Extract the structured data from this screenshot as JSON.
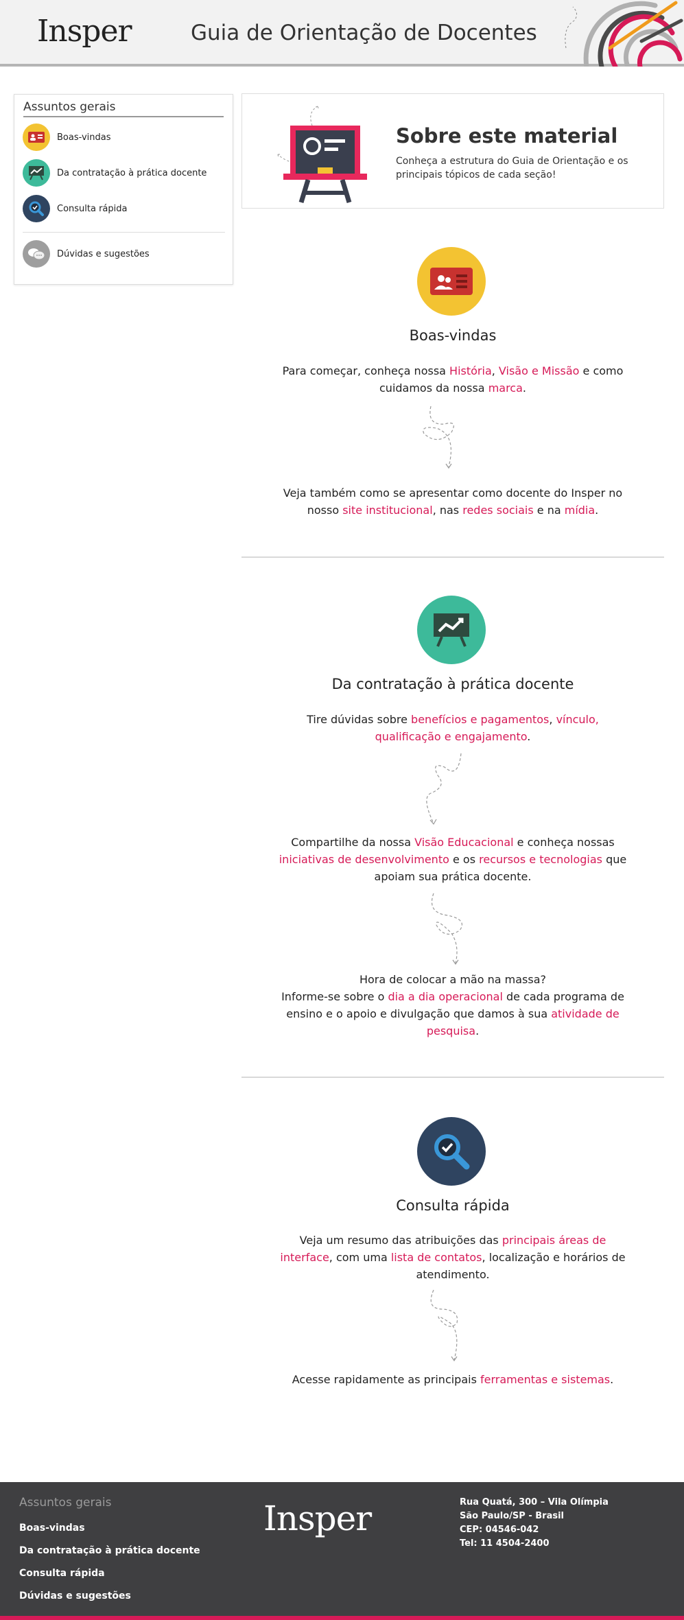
{
  "header": {
    "logo": "Insper",
    "title": "Guia de Orientação de Docentes"
  },
  "sidebar": {
    "title": "Assuntos gerais",
    "items": [
      {
        "label": "Boas-vindas",
        "color": "#f3c332"
      },
      {
        "label": "Da contratação à prática docente",
        "color": "#3dba9a"
      },
      {
        "label": "Consulta rápida",
        "color": "#2f4460"
      },
      {
        "label": "Dúvidas e sugestões",
        "color": "#9e9e9e"
      }
    ]
  },
  "sobre": {
    "title": "Sobre este material",
    "desc": "Conheça a estrutura do Guia de Orientação e os principais tópicos de cada seção!"
  },
  "s1": {
    "title": "Boas-vindas",
    "p1": {
      "a": "Para começar, conheça nossa ",
      "l1": "História",
      "b": ", ",
      "l2": "Visão e Missão",
      "c": " e como cuidamos da nossa ",
      "l3": "marca",
      "d": "."
    },
    "p2": {
      "a": "Veja também como se apresentar como docente do Insper no nosso ",
      "l1": "site institucional",
      "b": ", nas ",
      "l2": "redes sociais",
      "c": " e na ",
      "l3": "mídia",
      "d": "."
    }
  },
  "s2": {
    "title": "Da contratação à prática docente",
    "p1": {
      "a": "Tire dúvidas sobre ",
      "l1": "benefícios e pagamentos",
      "b": ", ",
      "l2": "vínculo,",
      "c": " ",
      "l3": "qualificação e engajamento",
      "d": "."
    },
    "p2": {
      "a": "Compartilhe da nossa ",
      "l1": "Visão Educacional",
      "b": " e conheça nossas ",
      "l2": "iniciativas de desenvolvimento",
      "c": " e os ",
      "l3": "recursos e tecnologias",
      "d": " que apoiam sua prática docente."
    },
    "p3": {
      "line1": "Hora de colocar a mão na massa?",
      "a": "Informe-se sobre o ",
      "l1": "dia a dia operacional",
      "b": " de cada programa de ensino e o apoio e divulgação que damos à sua ",
      "l2": "atividade de pesquisa",
      "c": "."
    }
  },
  "s3": {
    "title": "Consulta rápida",
    "p1": {
      "a": "Veja um resumo das atribuições das ",
      "l1": "principais áreas de interface",
      "b": ", com uma ",
      "l2": "lista de contatos",
      "c": ", localização e horários de atendimento."
    },
    "p2": {
      "a": "Acesse rapidamente as principais ",
      "l1": "ferramentas e sistemas",
      "b": "."
    }
  },
  "footer": {
    "title": "Assuntos gerais",
    "items": [
      "Boas-vindas",
      "Da contratação à prática docente",
      "Consulta rápida",
      "Dúvidas e sugestões"
    ],
    "logo": "Insper",
    "address": [
      "Rua Quatá, 300 – Vila Olímpia",
      "São Paulo/SP - Brasil",
      "CEP: 04546-042",
      "Tel: 11 4504-2400"
    ]
  },
  "colors": {
    "accent": "#d61a57",
    "yellow": "#f3c332",
    "green": "#3dba9a",
    "navy": "#2f4460",
    "gray": "#9e9e9e",
    "footer": "#3f3f41"
  },
  "icons": [
    "id-card-icon",
    "presentation-chart-icon",
    "magnifier-icon",
    "chat-bubbles-icon",
    "blackboard-icon"
  ]
}
